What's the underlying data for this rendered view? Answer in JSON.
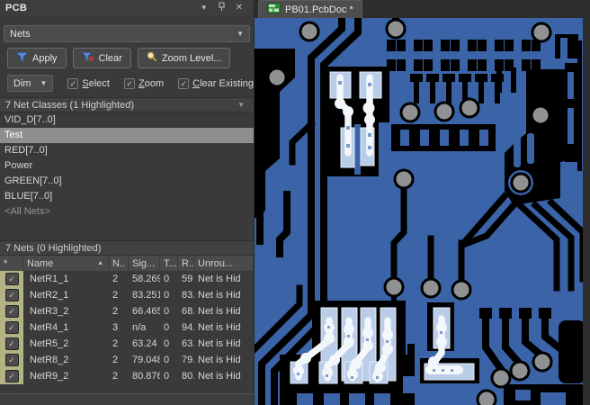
{
  "panel": {
    "title": "PCB",
    "selector_value": "Nets",
    "toolbar": {
      "apply": "Apply",
      "clear": "Clear",
      "zoom_level": "Zoom Level..."
    },
    "dim_value": "Dim",
    "checkboxes": [
      {
        "label": "Select",
        "checked": true
      },
      {
        "label": "Zoom",
        "checked": true
      },
      {
        "label": "Clear Existing",
        "checked": true
      }
    ],
    "net_classes": {
      "header": "7 Net Classes (1 Highlighted)",
      "items": [
        {
          "label": "VID_D[7..0]"
        },
        {
          "label": "Test",
          "selected": true
        },
        {
          "label": "RED[7..0]"
        },
        {
          "label": "Power"
        },
        {
          "label": "GREEN[7..0]"
        },
        {
          "label": "BLUE[7..0]"
        },
        {
          "label": "<All Nets>"
        }
      ]
    },
    "nets": {
      "header": "7 Nets (0 Highlighted)",
      "columns": {
        "star": "*",
        "name": "Name",
        "nodes": "N..",
        "signal": "Sig...",
        "track": "T...",
        "routed": "R...",
        "unrouted": "Unrou..."
      },
      "rows": [
        {
          "name": "NetR1_1",
          "nodes": "2",
          "signal": "58.269",
          "track": "0",
          "routed": "59",
          "unrouted": "Net is Hid"
        },
        {
          "name": "NetR2_1",
          "nodes": "2",
          "signal": "83.251",
          "track": "0",
          "routed": "83.",
          "unrouted": "Net is Hid"
        },
        {
          "name": "NetR3_2",
          "nodes": "2",
          "signal": "66.465",
          "track": "0",
          "routed": "68.",
          "unrouted": "Net is Hid"
        },
        {
          "name": "NetR4_1",
          "nodes": "3",
          "signal": "n/a",
          "track": "0",
          "routed": "94.",
          "unrouted": "Net is Hid"
        },
        {
          "name": "NetR5_2",
          "nodes": "2",
          "signal": "63.24",
          "track": "0",
          "routed": "63.",
          "unrouted": "Net is Hid"
        },
        {
          "name": "NetR8_2",
          "nodes": "2",
          "signal": "79.048",
          "track": "0",
          "routed": "79.",
          "unrouted": "Net is Hid"
        },
        {
          "name": "NetR9_2",
          "nodes": "2",
          "signal": "80.876",
          "track": "0",
          "routed": "80.",
          "unrouted": "Net is Hid"
        }
      ]
    }
  },
  "document": {
    "tab_label": "PB01.PcbDoc *"
  },
  "glyphs": {
    "dropdown": "▼",
    "close": "✕",
    "sort_asc": "▲",
    "check": "✓"
  },
  "pcb_colors": {
    "copper_dim": "#3b63a7",
    "clearance": "#000000",
    "via": "#8f9192",
    "pad_highlight": "#b9cde9",
    "trace_highlight": "#f3f6fb"
  }
}
